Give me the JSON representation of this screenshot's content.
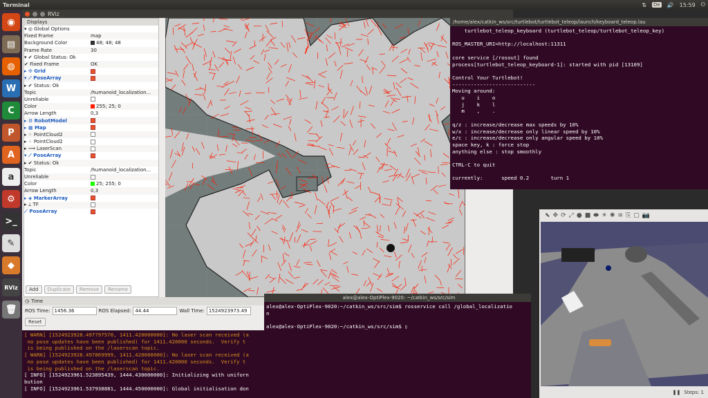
{
  "topbar": {
    "app_name": "Terminal",
    "keyboard": "De",
    "time": "15:59"
  },
  "launcher": {
    "items": [
      {
        "name": "ubuntu-dash",
        "glyph": "◉",
        "color": "#d34615"
      },
      {
        "name": "files",
        "glyph": "▤",
        "color": "#7e6b55"
      },
      {
        "name": "firefox",
        "glyph": "◍",
        "color": "#e66000"
      },
      {
        "name": "writer",
        "glyph": "W",
        "color": "#2a6fb4"
      },
      {
        "name": "calc",
        "glyph": "C",
        "color": "#1f8a3a"
      },
      {
        "name": "impress",
        "glyph": "P",
        "color": "#c0562b"
      },
      {
        "name": "software-center",
        "glyph": "A",
        "color": "#e0641f"
      },
      {
        "name": "amazon",
        "glyph": "a",
        "color": "#eeeeee"
      },
      {
        "name": "settings",
        "glyph": "⚙",
        "color": "#c0392b"
      },
      {
        "name": "terminal",
        "glyph": ">_",
        "color": "#333333"
      },
      {
        "name": "text-editor",
        "glyph": "✎",
        "color": "#dedede"
      },
      {
        "name": "install",
        "glyph": "◆",
        "color": "#d97a2a"
      },
      {
        "name": "rviz",
        "glyph": "RViz",
        "color": "#444444"
      },
      {
        "name": "trash",
        "glyph": "🗑",
        "color": "#777777"
      }
    ]
  },
  "rviz": {
    "title": "RViz",
    "displays_title": "Displays",
    "rows": [
      {
        "k": "▾ ◎ Global Options",
        "v": "",
        "cls": ""
      },
      {
        "k": "    Fixed Frame",
        "v": "map",
        "cls": ""
      },
      {
        "k": "    Background Color",
        "v": "48; 48; 48",
        "cls": "",
        "sw": "#303030"
      },
      {
        "k": "    Frame Rate",
        "v": "30",
        "cls": ""
      },
      {
        "k": "▾ ✔ Global Status: Ok",
        "v": "",
        "cls": ""
      },
      {
        "k": "      ✔ Fixed Frame",
        "v": "OK",
        "cls": ""
      },
      {
        "k": "▸ ✣ Grid",
        "v": "",
        "cls": "blue",
        "cb": true
      },
      {
        "k": "▾ ⟋ PoseArray",
        "v": "",
        "cls": "blue",
        "cb": true
      },
      {
        "k": "    ▸ ✔ Status: Ok",
        "v": "",
        "cls": ""
      },
      {
        "k": "    Topic",
        "v": "/humanoid_localization...",
        "cls": ""
      },
      {
        "k": "    Unreliable",
        "v": "",
        "cls": "",
        "cb": false
      },
      {
        "k": "    Color",
        "v": "255; 25; 0",
        "cls": "",
        "sw": "#ff1900"
      },
      {
        "k": "    Arrow Length",
        "v": "0,3",
        "cls": ""
      },
      {
        "k": "▸ ⚙ RobotModel",
        "v": "",
        "cls": "blue",
        "cb": true
      },
      {
        "k": "▸ ▦ Map",
        "v": "",
        "cls": "blue",
        "cb": true
      },
      {
        "k": "▸ ⁘ PointCloud2",
        "v": "",
        "cls": "",
        "cb": false
      },
      {
        "k": "▸ ⁘ PointCloud2",
        "v": "",
        "cls": "",
        "cb": false
      },
      {
        "k": "▸ ⟿ LaserScan",
        "v": "",
        "cls": "",
        "cb": false
      },
      {
        "k": "▾ ⟋ PoseArray",
        "v": "",
        "cls": "blue",
        "cb": true
      },
      {
        "k": "    ▸ ✔ Status: Ok",
        "v": "",
        "cls": ""
      },
      {
        "k": "    Topic",
        "v": "/humanoid_localization...",
        "cls": ""
      },
      {
        "k": "    Unreliable",
        "v": "",
        "cls": "",
        "cb": false
      },
      {
        "k": "    Color",
        "v": "25; 255; 0",
        "cls": "",
        "sw": "#19ff00"
      },
      {
        "k": "    Arrow Length",
        "v": "0,3",
        "cls": ""
      },
      {
        "k": "▸ ◈ MarkerArray",
        "v": "",
        "cls": "blue",
        "cb": true
      },
      {
        "k": "▸ ⟂ TF",
        "v": "",
        "cls": "",
        "cb": false
      },
      {
        "k": "  ⟋ PoseArray",
        "v": "",
        "cls": "blue",
        "cb": true
      }
    ],
    "buttons": {
      "add": "Add",
      "duplicate": "Duplicate",
      "remove": "Remove",
      "rename": "Rename"
    }
  },
  "time": {
    "title": "Time",
    "ros_time_label": "ROS Time:",
    "ros_time": "1456.36",
    "ros_elapsed_label": "ROS Elapsed:",
    "ros_elapsed": "44.44",
    "wall_time_label": "Wall Time:",
    "wall_time": "1524923973.49",
    "reset": "Reset"
  },
  "log": {
    "lines": [
      {
        "t": "[ WARN] [1524923928.497797570, 1411.420000000]: No laser scan received (a",
        "c": "#d98c1c"
      },
      {
        "t": " no pose updates have been published) for 1411.420000 seconds.  Verify t",
        "c": "#d98c1c"
      },
      {
        "t": " is being published on the /laserscan topic.",
        "c": "#d98c1c"
      },
      {
        "t": "[ WARN] [1524923928.497869999, 1411.420000000]: No laser scan received (a",
        "c": "#d98c1c"
      },
      {
        "t": " no pose updates have been published) for 1411.420000 seconds.  Verify t",
        "c": "#d98c1c"
      },
      {
        "t": " is being published on the /laserscan topic.",
        "c": "#d98c1c"
      },
      {
        "t": "[ INFO] [1524923961.523895439, 1444.430000000]: Initializing with uniforn",
        "c": "#ffffff"
      },
      {
        "t": "bution",
        "c": "#ffffff"
      },
      {
        "t": "[ INFO] [1524923961.537938881, 1444.450000000]: Global initialisation don",
        "c": "#ffffff"
      }
    ]
  },
  "teleop": {
    "title": "/home/alex/catkin_ws/src/turtlebot/turtlebot_teleop/launch/keyboard_teleop.lau",
    "lines": [
      "    turtlebot_teleop_keyboard (turtlebot_teleop/turtlebot_teleop_key)",
      "",
      "ROS_MASTER_URI=http://localhost:11311",
      "",
      "core service [/rosout] found",
      "process[turtlebot_teleop_keyboard-1]: started with pid [13109]",
      "",
      "Control Your Turtlebot!",
      "---------------------------",
      "Moving around:",
      "   u    i    o",
      "   j    k    l",
      "   m    ,    .",
      "",
      "q/z : increase/decrease max speeds by 10%",
      "w/x : increase/decrease only linear speed by 10%",
      "e/c : increase/decrease only angular speed by 10%",
      "space key, k : force stop",
      "anything else : stop smoothly",
      "",
      "CTRL-C to quit",
      "",
      "currently:      speed 0.2       turn 1"
    ]
  },
  "sim_term": {
    "title": "alex@alex-OptiPlex-9020: ~/catkin_ws/src/sim",
    "lines": [
      "alex@alex-OptiPlex-9020:~/catkin_ws/src/sim$ rosservice call /global_localizatio",
      "n",
      "",
      "alex@alex-OptiPlex-9020:~/catkin_ws/src/sim$ ▯"
    ]
  },
  "gazebo": {
    "tools": [
      "⬉",
      "✥",
      "⟳",
      "⤢",
      "●",
      "■",
      "⬬",
      "☀",
      "✺",
      "≡",
      "⎘",
      "▢",
      "📷"
    ],
    "steps_label": "Steps: 1"
  }
}
